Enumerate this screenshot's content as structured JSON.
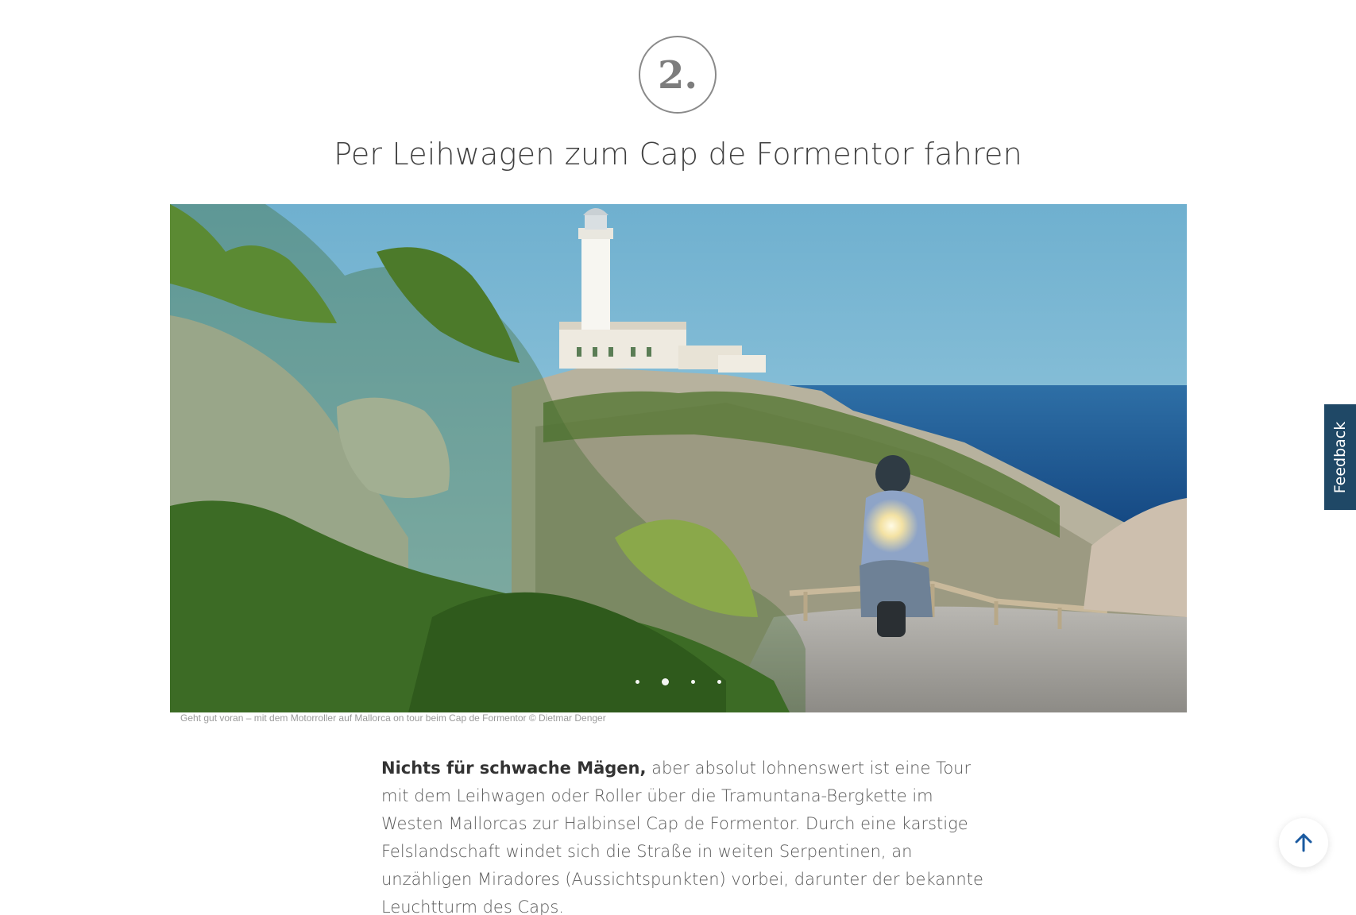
{
  "step": {
    "number": "2."
  },
  "section": {
    "title": "Per Leihwagen zum Cap de Formentor fahren"
  },
  "slider": {
    "slide_count": 4,
    "active_index": 1,
    "caption": "Geht gut voran – mit dem Motorroller auf Mallorca on tour beim Cap de Formentor © Dietmar Denger"
  },
  "article": {
    "lead": "Nichts für schwache Mägen,",
    "text": " aber absolut lohnenswert ist eine Tour mit dem Leihwagen oder Roller über die Tramuntana-Bergkette im Westen Mallorcas zur Halbinsel Cap de Formentor. Durch eine karstige Felslandschaft windet sich die Straße in weiten Serpentinen, an unzähligen Miradores (Aussichtspunkten) vorbei, darunter der bekannte Leuchtturm des Caps."
  },
  "feedback": {
    "label": "Feedback",
    "color": "#1f4866"
  },
  "scroll_top": {
    "icon": "arrow-up-icon",
    "color": "#1a5aa0"
  }
}
